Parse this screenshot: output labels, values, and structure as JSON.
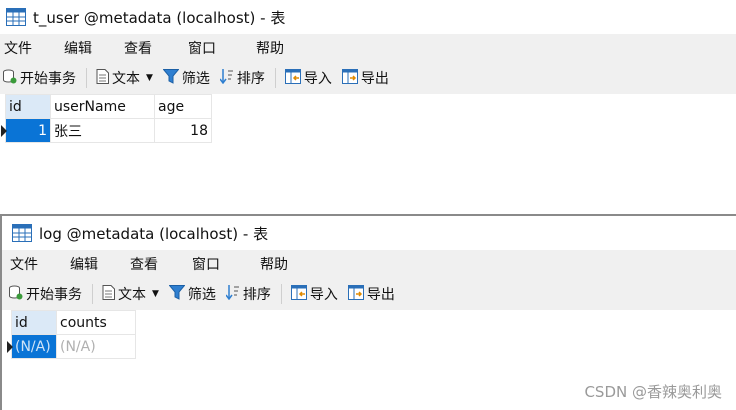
{
  "window1": {
    "title": "t_user @metadata (localhost) - 表",
    "menu": [
      "文件",
      "编辑",
      "查看",
      "窗口",
      "帮助"
    ],
    "toolbar": {
      "begin_transaction": "开始事务",
      "text": "文本",
      "filter": "筛选",
      "sort": "排序",
      "import": "导入",
      "export": "导出"
    },
    "table": {
      "columns": [
        "id",
        "userName",
        "age"
      ],
      "rows": [
        [
          "1",
          "张三",
          "18"
        ]
      ]
    }
  },
  "window2": {
    "title": "log @metadata (localhost) - 表",
    "menu": [
      "文件",
      "编辑",
      "查看",
      "窗口",
      "帮助"
    ],
    "toolbar": {
      "begin_transaction": "开始事务",
      "text": "文本",
      "filter": "筛选",
      "sort": "排序",
      "import": "导入",
      "export": "导出"
    },
    "table": {
      "columns": [
        "id",
        "counts"
      ],
      "rows": [
        [
          "(N/A)",
          "(N/A)"
        ]
      ]
    }
  },
  "watermark": "CSDN @香辣奥利奥",
  "colors": {
    "selection": "#0a74d6",
    "selected_header": "#dbe9f7",
    "toolbar_bg": "#f0f0f0"
  }
}
